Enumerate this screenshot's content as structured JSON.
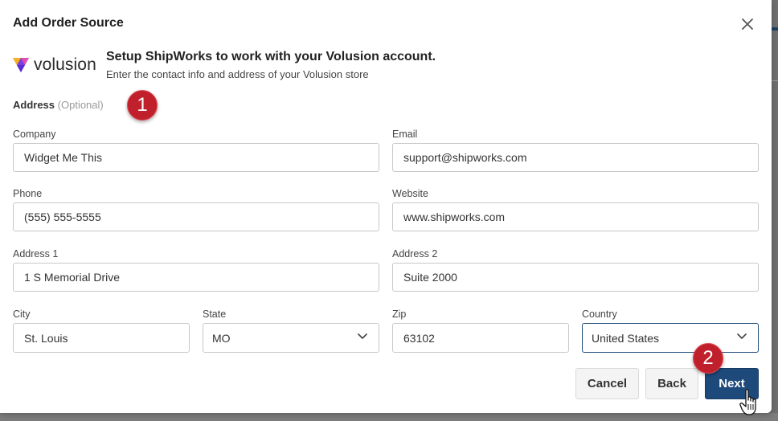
{
  "dialog": {
    "title": "Add Order Source",
    "close_icon": "close-icon"
  },
  "brand": {
    "logo_icon": "volusion-logo-icon",
    "name": "volusion"
  },
  "intro": {
    "heading": "Setup ShipWorks to work with your Volusion account.",
    "subheading": "Enter the contact info and address of your Volusion store"
  },
  "section": {
    "label": "Address",
    "optional": "(Optional)"
  },
  "callouts": [
    "1",
    "2"
  ],
  "fields": {
    "company": {
      "label": "Company",
      "value": "Widget Me This"
    },
    "email": {
      "label": "Email",
      "value": "support@shipworks.com"
    },
    "phone": {
      "label": "Phone",
      "value": "(555) 555-5555"
    },
    "website": {
      "label": "Website",
      "value": "www.shipworks.com"
    },
    "address1": {
      "label": "Address 1",
      "value": "1 S Memorial Drive"
    },
    "address2": {
      "label": "Address 2",
      "value": "Suite 2000"
    },
    "city": {
      "label": "City",
      "value": "St. Louis"
    },
    "state": {
      "label": "State",
      "value": "MO"
    },
    "zip": {
      "label": "Zip",
      "value": "63102"
    },
    "country": {
      "label": "Country",
      "value": "United States"
    }
  },
  "buttons": {
    "cancel": "Cancel",
    "back": "Back",
    "next": "Next"
  },
  "colors": {
    "primary": "#1e4a7b",
    "callout": "#c0202b"
  }
}
